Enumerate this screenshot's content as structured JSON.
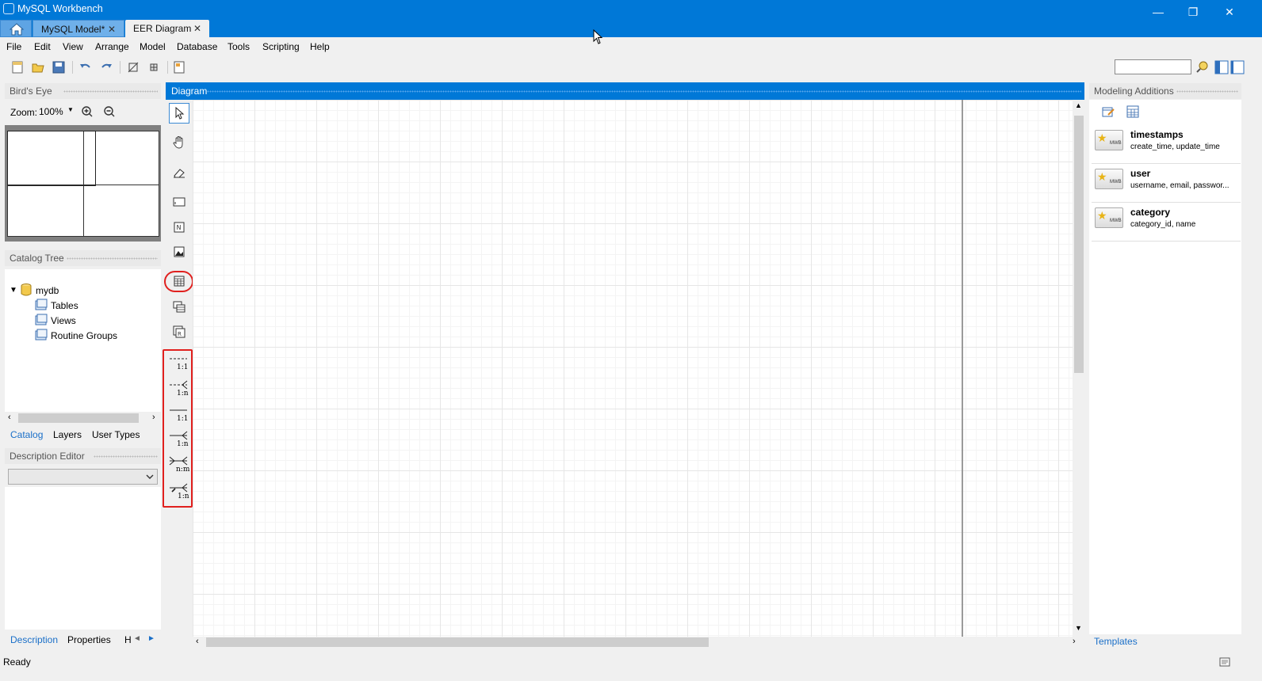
{
  "window": {
    "title": "MySQL Workbench",
    "controls": {
      "minimize": "—",
      "restore": "❐",
      "close": "✕"
    }
  },
  "tabs": [
    {
      "label": "MySQL Model*"
    },
    {
      "label": "EER Diagram"
    }
  ],
  "menu": [
    "File",
    "Edit",
    "View",
    "Arrange",
    "Model",
    "Database",
    "Tools",
    "Scripting",
    "Help"
  ],
  "birds_eye": {
    "header": "Bird's Eye",
    "zoom_label": "Zoom:",
    "zoom_value": "100%"
  },
  "catalog": {
    "header": "Catalog Tree",
    "root": "mydb",
    "children": [
      "Tables",
      "Views",
      "Routine Groups"
    ],
    "tabs": [
      "Catalog",
      "Layers",
      "User Types"
    ]
  },
  "description": {
    "header": "Description Editor",
    "bottom_tabs": [
      "Description",
      "Properties",
      "H"
    ]
  },
  "diagram": {
    "header": "Diagram",
    "relationship_labels": [
      "1:1",
      "1:n",
      "1:1",
      "1:n",
      "n:m",
      "1:n"
    ]
  },
  "modeling_additions": {
    "header": "Modeling Additions",
    "templates": [
      {
        "name": "timestamps",
        "columns": "create_time, update_time"
      },
      {
        "name": "user",
        "columns": "username, email, passwor..."
      },
      {
        "name": "category",
        "columns": "category_id, name"
      }
    ],
    "footer_tab": "Templates",
    "badge": "MWB"
  },
  "status": {
    "text": "Ready"
  }
}
